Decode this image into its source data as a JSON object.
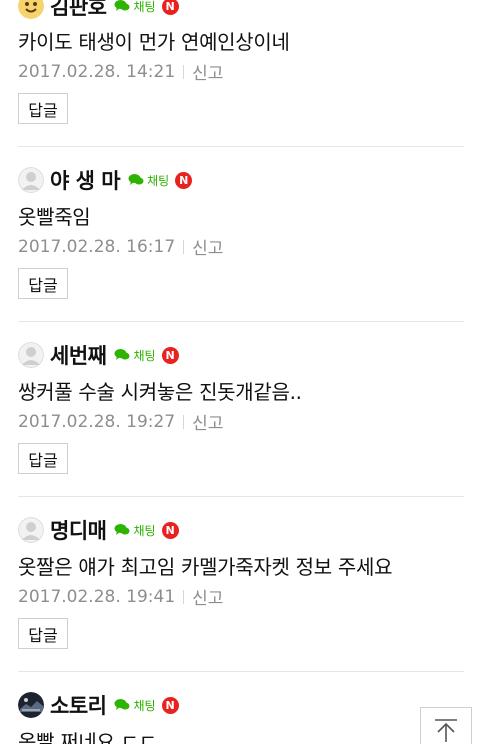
{
  "comments": [
    {
      "nickname": "김판호",
      "avatar_icon": "emoji-avatar-icon",
      "chat_label": "채팅",
      "new_badge": "N",
      "text": "카이도 태생이 먼가 연예인상이네",
      "timestamp": "2017.02.28. 14:21",
      "report_label": "신고",
      "reply_label": "답글"
    },
    {
      "nickname": "야 생 마",
      "avatar_icon": "default-profile-icon",
      "chat_label": "채팅",
      "new_badge": "N",
      "text": "옷빨죽임",
      "timestamp": "2017.02.28. 16:17",
      "report_label": "신고",
      "reply_label": "답글"
    },
    {
      "nickname": "세번째",
      "avatar_icon": "default-profile-icon",
      "chat_label": "채팅",
      "new_badge": "N",
      "text": "쌍커풀 수술 시켜놓은 진돗개같음..",
      "timestamp": "2017.02.28. 19:27",
      "report_label": "신고",
      "reply_label": "답글"
    },
    {
      "nickname": "명디매",
      "avatar_icon": "default-profile-icon",
      "chat_label": "채팅",
      "new_badge": "N",
      "text": "옷짤은 얘가 최고임 카멜가죽자켓 정보 주세요",
      "timestamp": "2017.02.28. 19:41",
      "report_label": "신고",
      "reply_label": "답글"
    },
    {
      "nickname": "소토리",
      "avatar_icon": "photo-avatar-icon",
      "chat_label": "채팅",
      "new_badge": "N",
      "text": "옷빨 쩌네요 ㄷㄷ",
      "timestamp": "",
      "report_label": "",
      "reply_label": ""
    }
  ],
  "scroll_top_icon": "scroll-to-top-icon",
  "colors": {
    "chat_green": "#2db400",
    "new_badge_red": "#e8231f",
    "meta_gray": "#8e8e8e",
    "separator": "#e6e6e6"
  }
}
